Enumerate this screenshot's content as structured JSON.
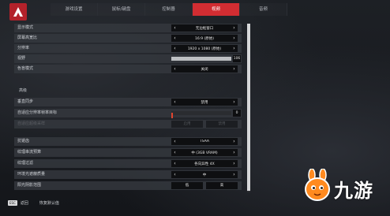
{
  "nav": {
    "tabs": [
      {
        "label": "游戏设置",
        "active": false
      },
      {
        "label": "鼠标/键盘",
        "active": false
      },
      {
        "label": "控制器",
        "active": false
      },
      {
        "label": "视频",
        "active": true
      },
      {
        "label": "音频",
        "active": false
      }
    ]
  },
  "settings": {
    "rows": [
      {
        "label": "显示模式",
        "value": "无边框窗口"
      },
      {
        "label": "屏幕高宽比",
        "value": "16:9 (原始)"
      },
      {
        "label": "分辨率",
        "value": "1920 x 1080 (原始)"
      },
      {
        "label": "视野",
        "slider_value": "106"
      },
      {
        "label": "色盲模式",
        "value": "关闭"
      }
    ],
    "advanced_header": "高级",
    "advanced_rows": [
      {
        "label": "垂直同步",
        "value": "禁用"
      },
      {
        "label": "自适应分辨率帧率目标",
        "slider_value": "0"
      },
      {
        "label": "自适应超级采样",
        "options": [
          "启用",
          "禁用"
        ],
        "disabled": true
      },
      {
        "label": "抗锯齿",
        "value": "TSAA"
      },
      {
        "label": "纹理串流预算",
        "value": "中 (3GB VRAM)"
      },
      {
        "label": "纹理过滤",
        "value": "各向异性 4X"
      },
      {
        "label": "环境光遮蔽质量",
        "value": "中"
      },
      {
        "label": "阳光阴影范围",
        "options": [
          "低",
          "高"
        ]
      }
    ]
  },
  "footer": {
    "esc_key": "ESC",
    "back_label": "返回",
    "restore_label": "恢复默认值"
  },
  "watermark": {
    "text": "九游"
  },
  "colors": {
    "accent": "#d22d32",
    "row_bg": "#34373d",
    "selector_bg": "#0e0f11"
  }
}
